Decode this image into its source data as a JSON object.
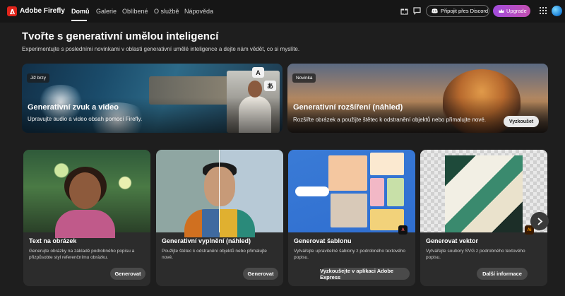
{
  "app": {
    "title": "Adobe Firefly"
  },
  "nav": {
    "links": [
      "Domů",
      "Galerie",
      "Oblíbené",
      "O službě",
      "Nápověda"
    ],
    "discord_label": "Připojit přes Discord",
    "upgrade_label": "Upgrade"
  },
  "header": {
    "title": "Tvořte s generativní umělou inteligencí",
    "subtitle": "Experimentujte s posledními novinkami v oblasti generativní umělé inteligence a dejte nám vědět, co si myslíte."
  },
  "hero": [
    {
      "badge": "Již brzy",
      "title": "Generativní zvuk a video",
      "description": "Upravujte audio a video obsah pomocí Firefly.",
      "chips": [
        "A",
        "あ"
      ]
    },
    {
      "badge": "Novinka",
      "title": "Generativní rozšíření (náhled)",
      "description": "Rozšiřte obrázek a použijte štětec k odstranění objektů nebo přimalujte nové.",
      "button": "Vyzkoušet"
    }
  ],
  "cards": [
    {
      "title": "Text na obrázek",
      "description": "Generujte obrázky na základě podrobného popisu a přizpůsobte styl referenčnímu obrázku.",
      "button": "Generovat"
    },
    {
      "title": "Generativní vyplnění (náhled)",
      "description": "Použijte štětec k odstranění objektů nebo přimalujte nové.",
      "button": "Generovat"
    },
    {
      "title": "Generovat šablonu",
      "description": "Vytvářejte upravitelné šablony z podrobného textového popisu.",
      "button": "Vyzkoušejte v aplikaci Adobe Express"
    },
    {
      "title": "Generovat vektor",
      "description": "Vytvářejte soubory SVG z podrobného textového popisu.",
      "button": "Další informace"
    }
  ],
  "colors": {
    "brand": "#e1251b",
    "upgrade": "#a24cdd",
    "background": "#1e1e1e"
  }
}
